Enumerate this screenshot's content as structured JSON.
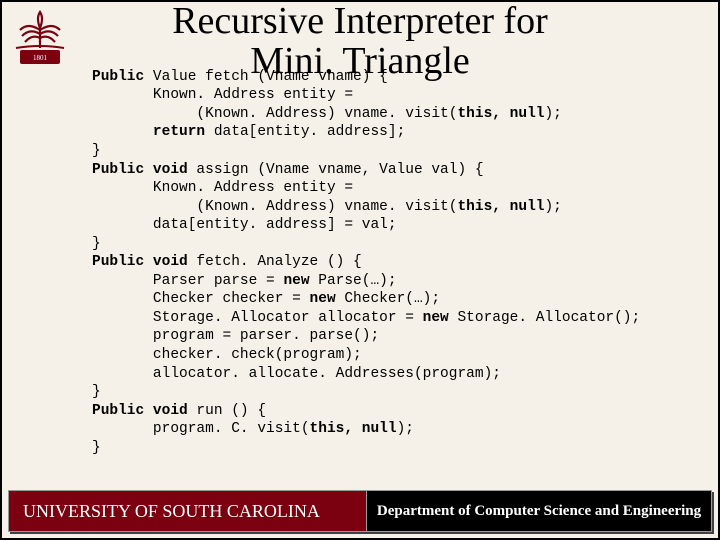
{
  "title_line1": "Recursive Interpreter for",
  "title_line2": "Mini. Triangle",
  "code": {
    "l1a": "Public",
    "l1b": " Value fetch (Vname vname) {",
    "l2": "       Known. Address entity =",
    "l3a": "            (Known. Address) vname. visit(",
    "l3b": "this, null",
    "l3c": ");",
    "l4a": "       ",
    "l4b": "return",
    "l4c": " data[entity. address];",
    "l5": "}",
    "l6a": "Public void",
    "l6b": " assign (Vname vname, Value val) {",
    "l7": "       Known. Address entity =",
    "l8a": "            (Known. Address) vname. visit(",
    "l8b": "this, null",
    "l8c": ");",
    "l9": "       data[entity. address] = val;",
    "l10": "}",
    "l11a": "Public void",
    "l11b": " fetch. Analyze () {",
    "l12a": "       Parser parse = ",
    "l12b": "new",
    "l12c": " Parse(…);",
    "l13a": "       Checker checker = ",
    "l13b": "new",
    "l13c": " Checker(…);",
    "l14a": "       Storage. Allocator allocator = ",
    "l14b": "new",
    "l14c": " Storage. Allocator();",
    "l15": "       program = parser. parse();",
    "l16": "       checker. check(program);",
    "l17": "       allocator. allocate. Addresses(program);",
    "l18": "}",
    "l19a": "Public void",
    "l19b": " run () {",
    "l20a": "       program. C. visit(",
    "l20b": "this, null",
    "l20c": ");",
    "l21": "}"
  },
  "footer": {
    "left": "UNIVERSITY OF SOUTH CAROLINA",
    "right": "Department of Computer Science and Engineering"
  }
}
